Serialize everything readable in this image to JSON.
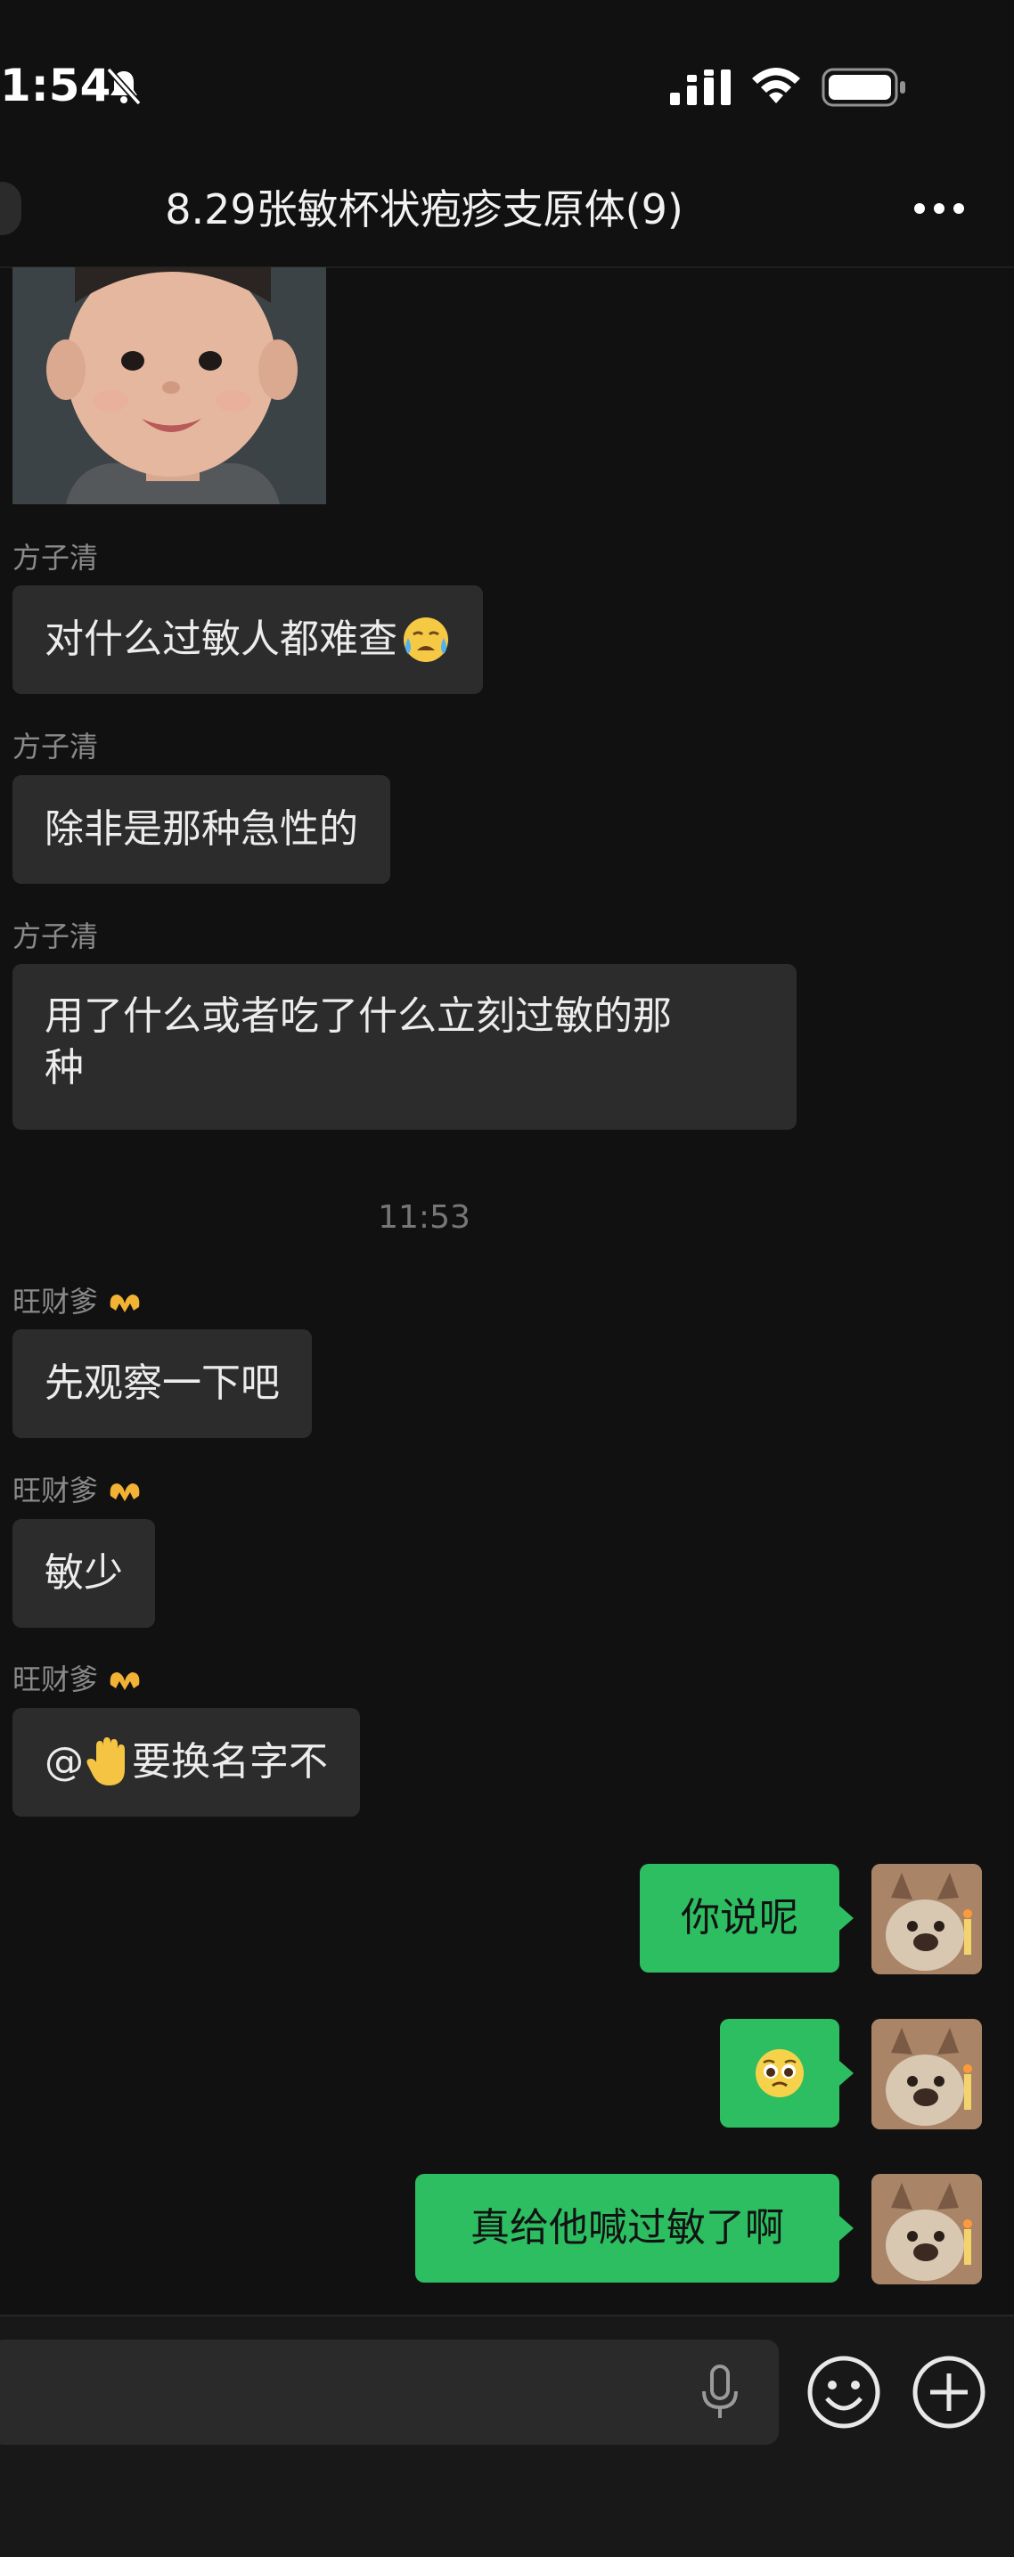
{
  "status_bar": {
    "time": "1:54"
  },
  "header": {
    "title": "8.29张敏杯状疱疹支原体(9)"
  },
  "messages": {
    "m1": {
      "sender": "方子清",
      "text": "对什么过敏人都难查"
    },
    "m2": {
      "sender": "方子清",
      "text": "除非是那种急性的"
    },
    "m3": {
      "sender": "方子清",
      "text_line1": "用了什么或者吃了什么立刻过敏的那",
      "text_line2": "种"
    },
    "timestamp": "11:53",
    "m4": {
      "sender": "旺财爹",
      "text": "先观察一下吧"
    },
    "m5": {
      "sender": "旺财爹",
      "text": "敏少"
    },
    "m6": {
      "sender": "旺财爹",
      "prefix": "@",
      "text": " 要换名字不"
    },
    "out1": {
      "text": "你说呢"
    },
    "out3": {
      "text": "真给他喊过敏了啊"
    }
  },
  "input": {
    "placeholder": ""
  },
  "colors": {
    "background": "#111111",
    "incoming_bubble": "#2c2c2c",
    "outgoing_bubble": "#2dbe62",
    "sender_name": "#8a8a8a"
  },
  "icons": [
    "bell-slash-icon",
    "signal-icon",
    "wifi-icon",
    "battery-icon",
    "more-icon",
    "microphone-icon",
    "emoji-icon",
    "plus-icon",
    "heart-hands-emoji",
    "hand-emoji",
    "crying-emoji",
    "pleading-emoji"
  ]
}
